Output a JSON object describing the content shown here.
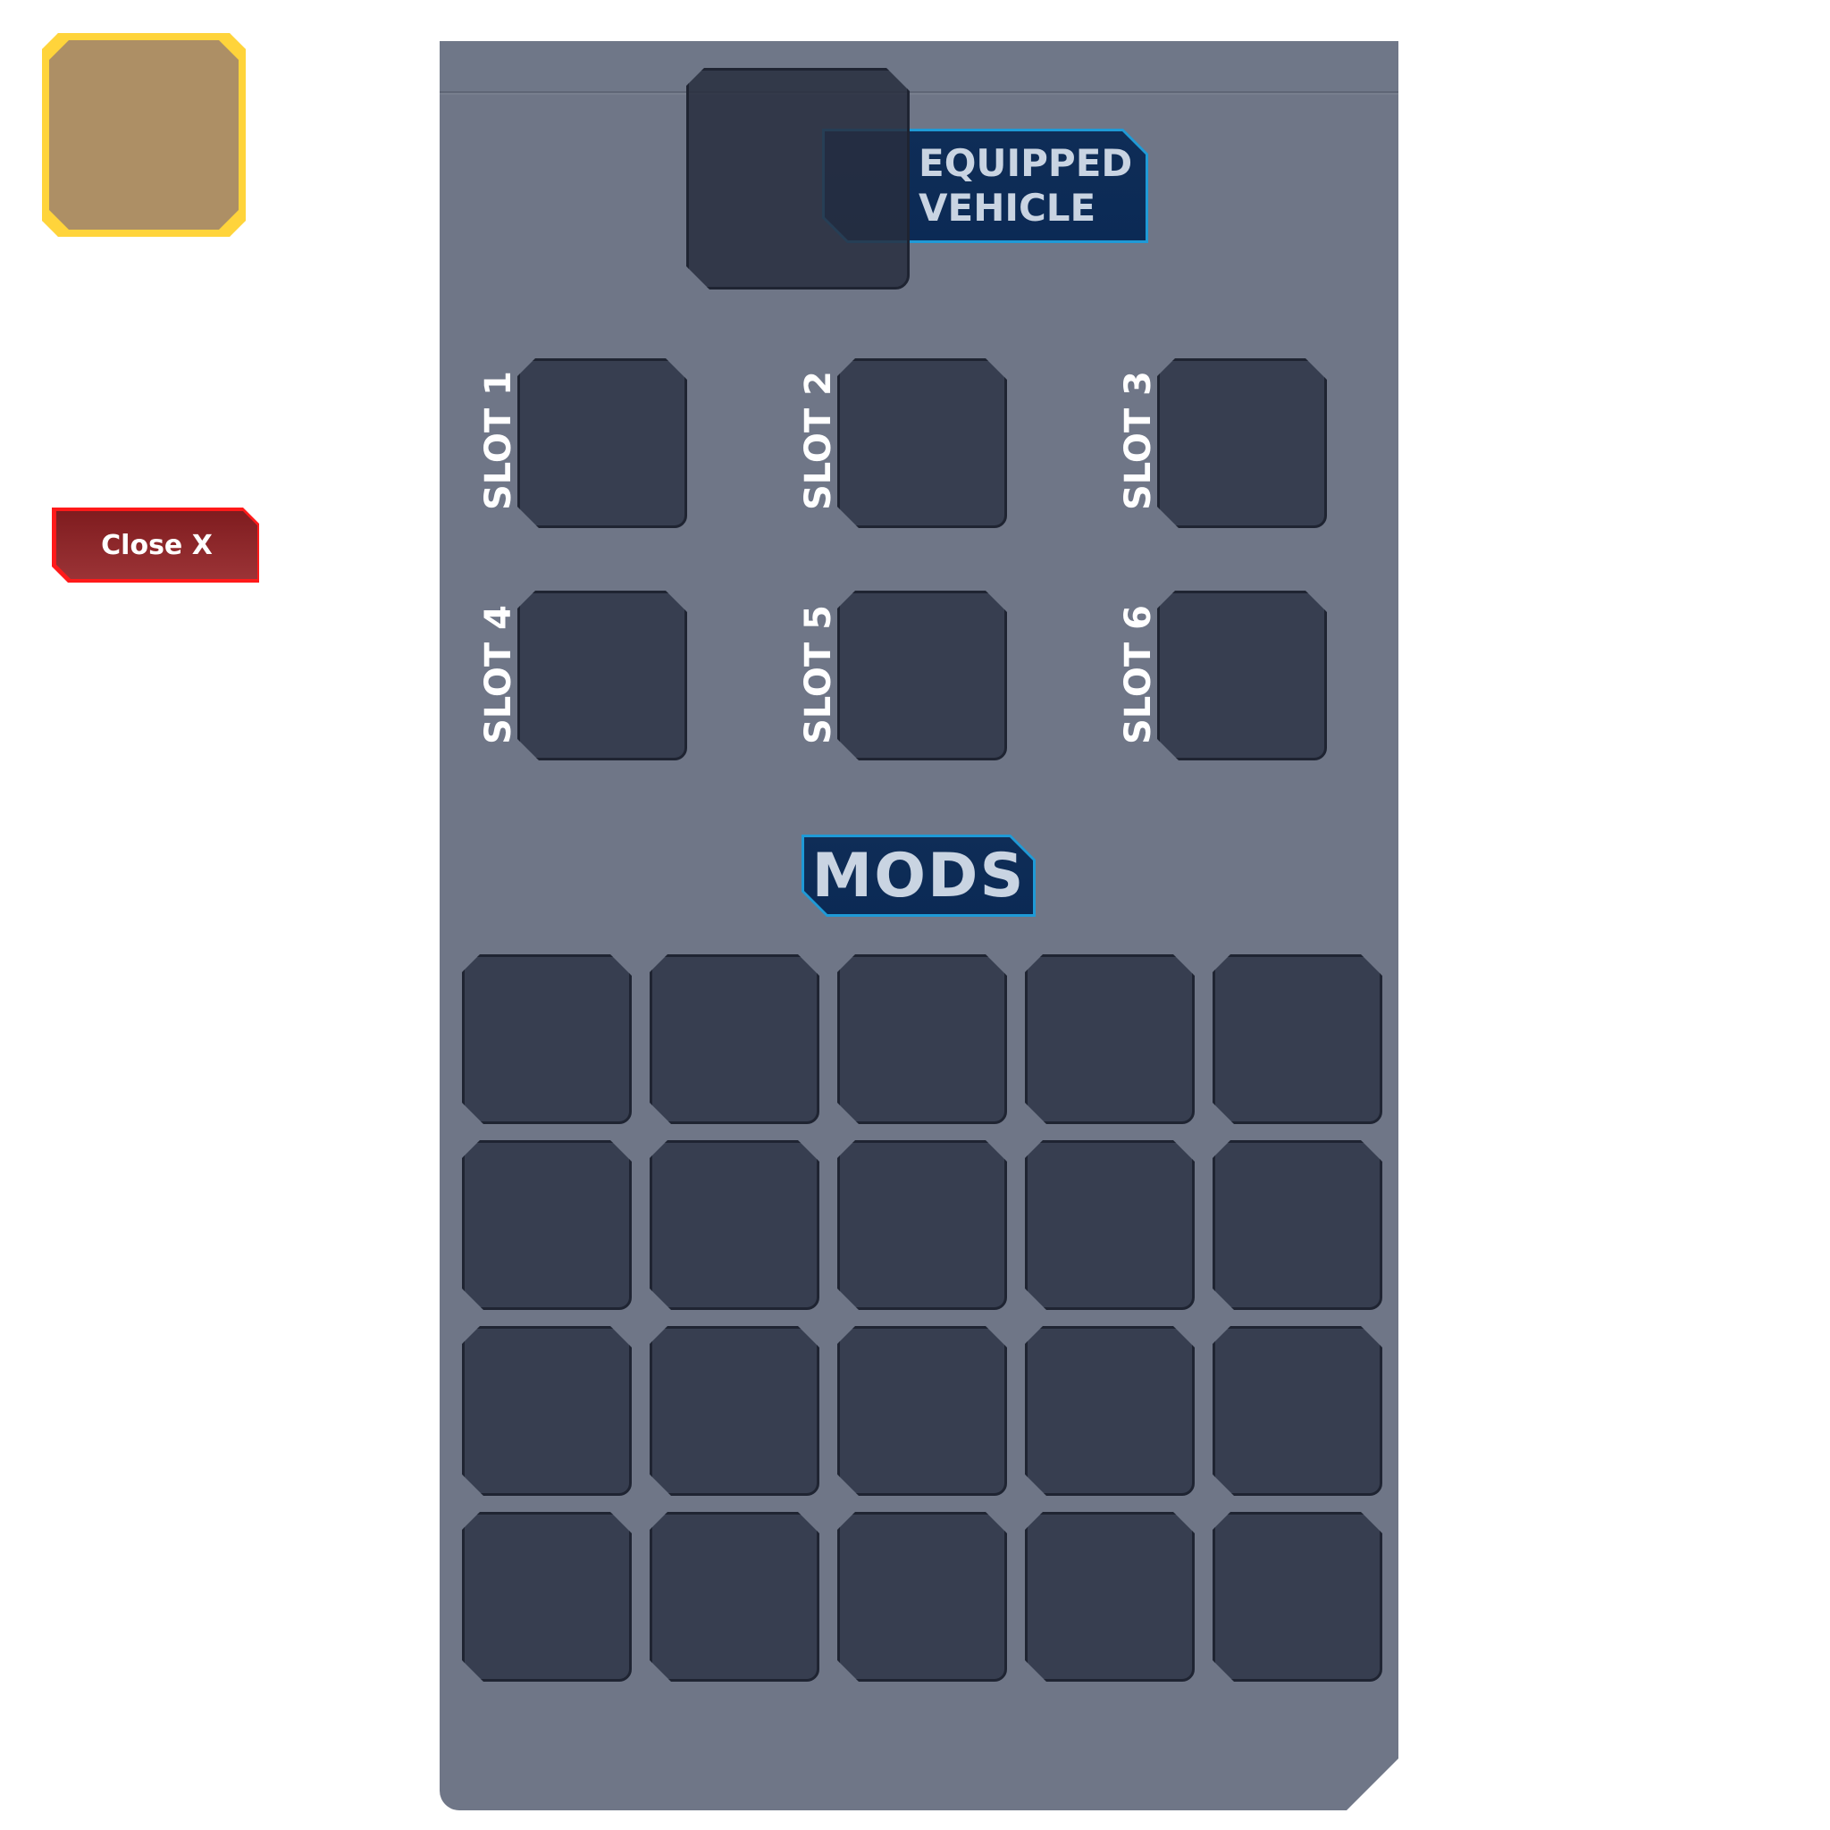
{
  "close_button": {
    "label": "Close X"
  },
  "equipped_vehicle": {
    "label_line1": "EQUIPPED",
    "label_line2": "VEHICLE"
  },
  "slots": [
    {
      "label": "SLOT 1"
    },
    {
      "label": "SLOT 2"
    },
    {
      "label": "SLOT 3"
    },
    {
      "label": "SLOT 4"
    },
    {
      "label": "SLOT 5"
    },
    {
      "label": "SLOT 6"
    }
  ],
  "mods": {
    "label": "MODS",
    "grid": {
      "rows": 4,
      "columns": 5
    }
  },
  "colors": {
    "panel": "#6f7687",
    "slot": "#373e50",
    "banner": "#0b2a55",
    "banner_border": "#1f9ad6",
    "close_button": "#7f1c1f",
    "item_frame": "#ffd43b",
    "item_fill": "#ad8f65"
  }
}
